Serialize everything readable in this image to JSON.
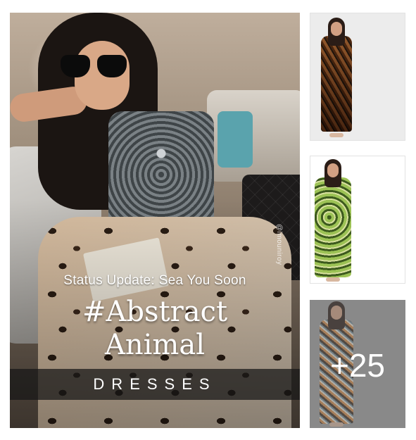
{
  "hero": {
    "status_text": "Status Update: Sea You Soon",
    "title_line1": "#Abstract",
    "title_line2": "Animal",
    "banner_text": "DRESSES",
    "watermark": "@imouniroy"
  },
  "thumbnails": [
    {
      "label": ""
    },
    {
      "label": ""
    },
    {
      "label": "",
      "more_count": "+25"
    }
  ],
  "colors": {
    "page_background": "#ffffff",
    "banner_background": "#161616",
    "overlay_text": "#ffffff"
  }
}
